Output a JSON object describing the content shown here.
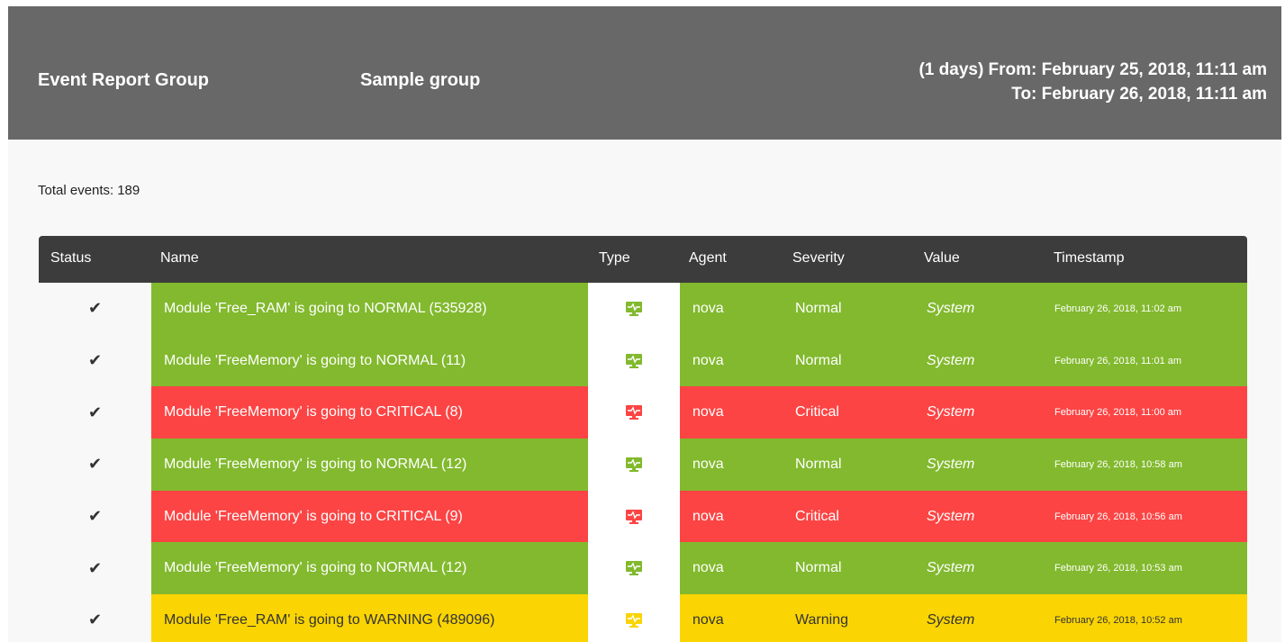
{
  "header": {
    "title": "Event Report Group",
    "group": "Sample group",
    "range_line1": "(1 days) From: February 25, 2018, 11:11 am",
    "range_line2": "To: February 26, 2018, 11:11 am"
  },
  "summary": {
    "total_label": "Total events:",
    "total_value": "189"
  },
  "colors": {
    "normal": "#82b92e",
    "critical": "#fc4444",
    "warning": "#fad403",
    "header_bg": "#686868",
    "table_header_bg": "#3c3c3c"
  },
  "table": {
    "columns": [
      "Status",
      "Name",
      "Type",
      "Agent",
      "Severity",
      "Value",
      "Timestamp"
    ],
    "rows": [
      {
        "status_icon": "check-icon",
        "name": "Module 'Free_RAM' is going to NORMAL (535928)",
        "type_icon": "monitor-icon",
        "agent": "nova",
        "severity": "Normal",
        "value": "System",
        "timestamp": "February 26, 2018, 11:02 am"
      },
      {
        "status_icon": "check-icon",
        "name": "Module 'FreeMemory' is going to NORMAL (11)",
        "type_icon": "monitor-icon",
        "agent": "nova",
        "severity": "Normal",
        "value": "System",
        "timestamp": "February 26, 2018, 11:01 am"
      },
      {
        "status_icon": "check-icon",
        "name": "Module 'FreeMemory' is going to CRITICAL (8)",
        "type_icon": "monitor-icon",
        "agent": "nova",
        "severity": "Critical",
        "value": "System",
        "timestamp": "February 26, 2018, 11:00 am"
      },
      {
        "status_icon": "check-icon",
        "name": "Module 'FreeMemory' is going to NORMAL (12)",
        "type_icon": "monitor-icon",
        "agent": "nova",
        "severity": "Normal",
        "value": "System",
        "timestamp": "February 26, 2018, 10:58 am"
      },
      {
        "status_icon": "check-icon",
        "name": "Module 'FreeMemory' is going to CRITICAL (9)",
        "type_icon": "monitor-icon",
        "agent": "nova",
        "severity": "Critical",
        "value": "System",
        "timestamp": "February 26, 2018, 10:56 am"
      },
      {
        "status_icon": "check-icon",
        "name": "Module 'FreeMemory' is going to NORMAL (12)",
        "type_icon": "monitor-icon",
        "agent": "nova",
        "severity": "Normal",
        "value": "System",
        "timestamp": "February 26, 2018, 10:53 am"
      },
      {
        "status_icon": "check-icon",
        "name": "Module 'Free_RAM' is going to WARNING (489096)",
        "type_icon": "monitor-icon",
        "agent": "nova",
        "severity": "Warning",
        "value": "System",
        "timestamp": "February 26, 2018, 10:52 am"
      }
    ]
  }
}
